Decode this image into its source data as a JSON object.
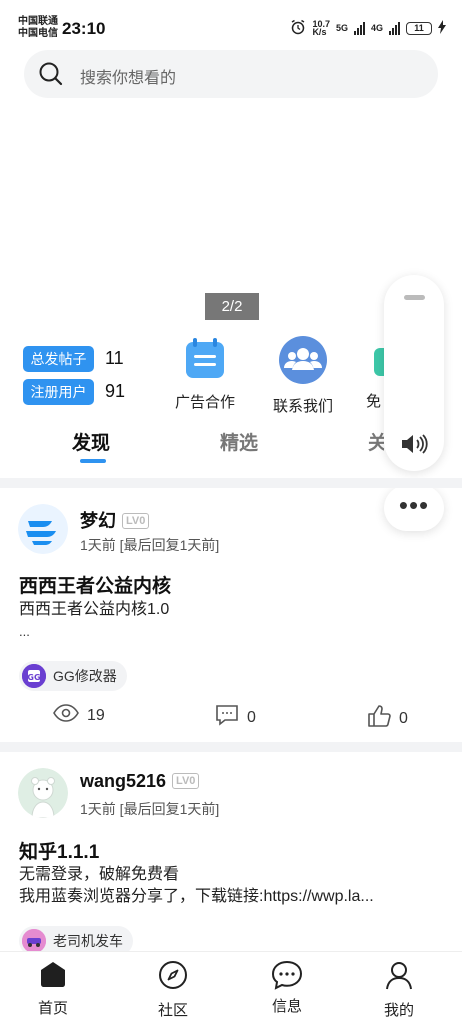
{
  "statusbar": {
    "carrier1": "中国联通",
    "carrier2": "中国电信",
    "time": "23:10",
    "speed": "10.7\nK/s",
    "net1": "5G",
    "net2": "4G",
    "battery": "11"
  },
  "search": {
    "placeholder": "搜索你想看的"
  },
  "banner": {
    "pager": "2/2"
  },
  "stats": [
    {
      "label": "总发帖子",
      "value": "11"
    },
    {
      "label": "注册用户",
      "value": "91"
    }
  ],
  "quick_links": [
    {
      "label": "广告合作",
      "icon": "notepad-icon"
    },
    {
      "label": "联系我们",
      "icon": "group-icon"
    },
    {
      "label": "免",
      "icon": "app-icon"
    }
  ],
  "tabs": [
    "发现",
    "精选",
    "关"
  ],
  "posts": [
    {
      "user": "梦幻",
      "level": "LV0",
      "meta": "1天前 [最后回复1天前]",
      "title": "西西王者公益内核",
      "body": "西西王者公益内核1.0",
      "more": "...",
      "tag": "GG修改器",
      "views": "19",
      "comments": "0",
      "likes": "0"
    },
    {
      "user": "wang5216",
      "level": "LV0",
      "meta": "1天前 [最后回复1天前]",
      "title": "知乎1.1.1",
      "body1": "无需登录，破解免费看",
      "body2": "我用蓝奏浏览器分享了，下载链接:https://wwp.la...",
      "tag": "老司机发车"
    }
  ],
  "nav": [
    "首页",
    "社区",
    "信息",
    "我的"
  ],
  "colors": {
    "accent": "#2f93f0",
    "tab_underline": "#2f93f0",
    "divider": "#f2f3f5"
  }
}
